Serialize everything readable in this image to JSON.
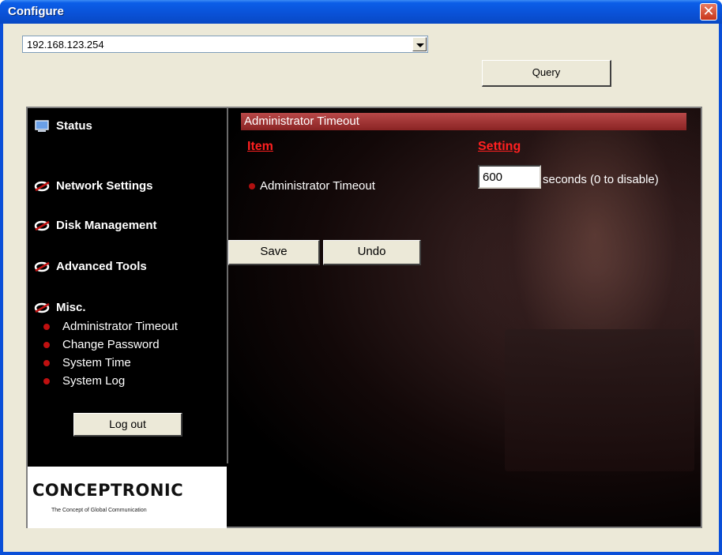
{
  "window": {
    "title": "Configure",
    "close_label": "✕"
  },
  "toolbar": {
    "address_value": "192.168.123.254",
    "query_label": "Query"
  },
  "sidebar": {
    "items": [
      {
        "label": "Status"
      },
      {
        "label": "Network Settings"
      },
      {
        "label": "Disk Management"
      },
      {
        "label": "Advanced Tools"
      },
      {
        "label": "Misc."
      }
    ],
    "sub_items": [
      {
        "label": "Administrator Timeout"
      },
      {
        "label": "Change Password"
      },
      {
        "label": "System Time"
      },
      {
        "label": "System Log"
      }
    ],
    "logout_label": "Log out",
    "logo_text": "CONCEPTRONIC",
    "logo_tagline": "The Concept of Global Communication"
  },
  "content": {
    "header": "Administrator Timeout",
    "col_item": "Item",
    "col_setting": "Setting",
    "row_label": "Administrator Timeout",
    "timeout_value": "600",
    "seconds_text": "seconds (0 to disable)",
    "save_label": "Save",
    "undo_label": "Undo"
  },
  "colors": {
    "accent_red": "#ff2020",
    "header_bar": "#a83434",
    "title_blue": "#0a52d8"
  }
}
